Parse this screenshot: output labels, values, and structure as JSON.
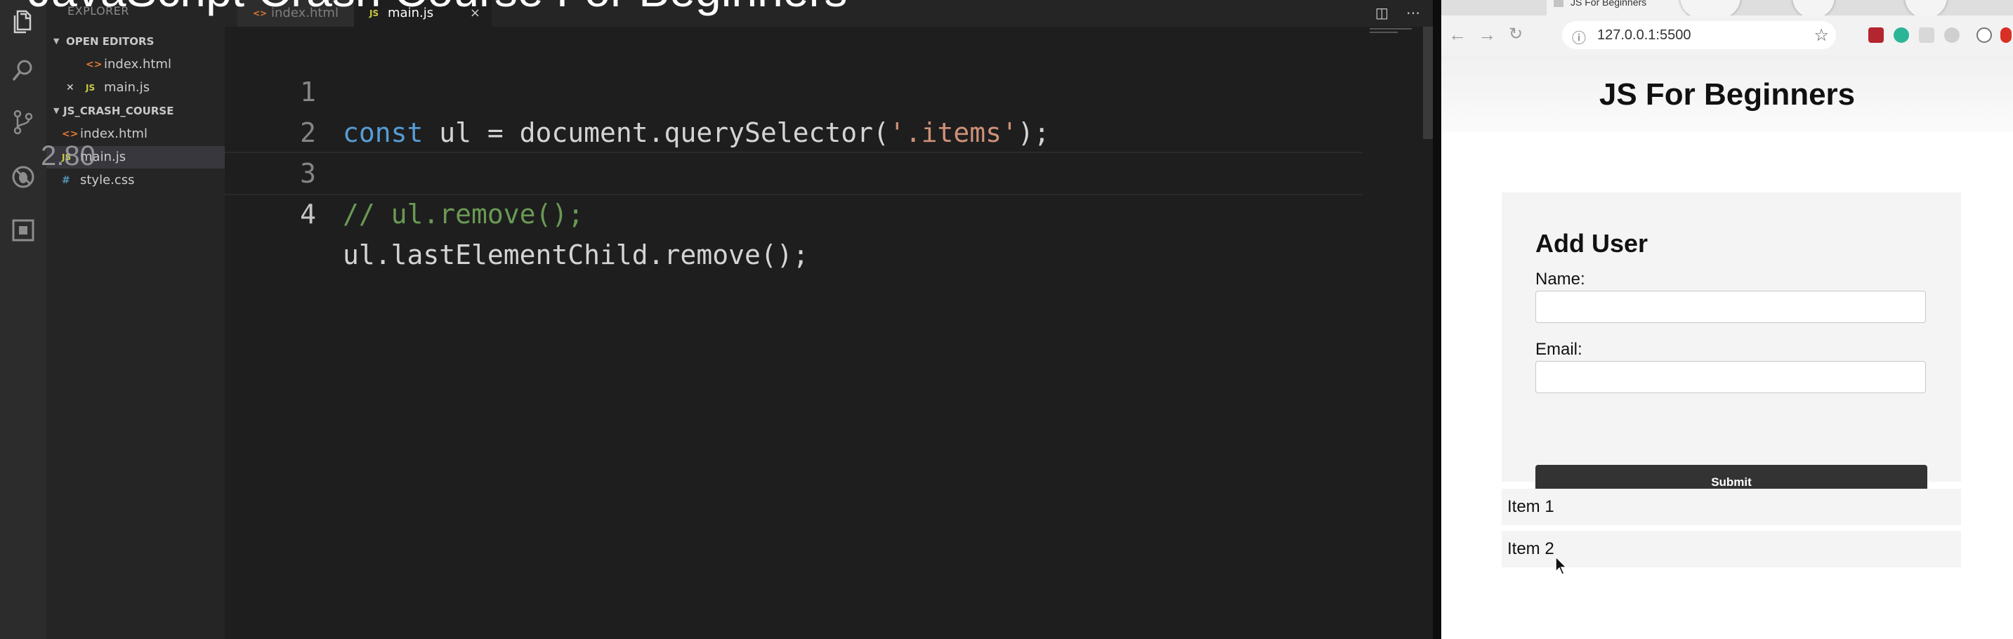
{
  "overlay": {
    "video_title": "JavaScript Crash Course For Beginners",
    "zoom_text": "2.80"
  },
  "sidebar": {
    "header": "EXPLORER",
    "open_editors_label": "OPEN EDITORS",
    "open_editors": [
      {
        "name": "index.html",
        "icon": "html-file-icon"
      },
      {
        "name": "main.js",
        "icon": "js-file-icon"
      }
    ],
    "project_label": "JS_CRASH_COURSE",
    "files": [
      {
        "name": "index.html",
        "icon": "html-file-icon"
      },
      {
        "name": "main.js",
        "icon": "js-file-icon"
      },
      {
        "name": "style.css",
        "icon": "css-file-icon"
      }
    ]
  },
  "editor": {
    "tabs": [
      {
        "label": "index.html",
        "active": false
      },
      {
        "label": "main.js",
        "active": true
      }
    ],
    "close_glyph": "×",
    "lines": [
      {
        "num": "1",
        "tokens": [
          {
            "text": "const",
            "type": "kw"
          },
          {
            "text": " ul = document.querySelector(",
            "type": "plain"
          },
          {
            "text": "'.items'",
            "type": "str"
          },
          {
            "text": ");",
            "type": "plain"
          }
        ]
      },
      {
        "num": "2",
        "tokens": []
      },
      {
        "num": "3",
        "tokens": [
          {
            "text": "// ul.remove();",
            "type": "cm"
          }
        ]
      },
      {
        "num": "4",
        "tokens": [
          {
            "text": "ul.lastElementChild.remove();",
            "type": "plain"
          }
        ]
      }
    ]
  },
  "browser": {
    "tab_title": "JS For Beginners",
    "url": "127.0.0.1:5500",
    "page": {
      "heading": "JS For Beginners",
      "form": {
        "title": "Add User",
        "name_label": "Name:",
        "name_value": "",
        "email_label": "Email:",
        "email_value": "",
        "submit_label": "Submit"
      },
      "items": [
        "Item 1",
        "Item 2"
      ]
    }
  },
  "colors": {
    "editor_bg": "#1e1e1e",
    "keyword": "#569cd6",
    "string": "#ce9178",
    "comment": "#6a9955",
    "submit_bg": "#333333"
  }
}
